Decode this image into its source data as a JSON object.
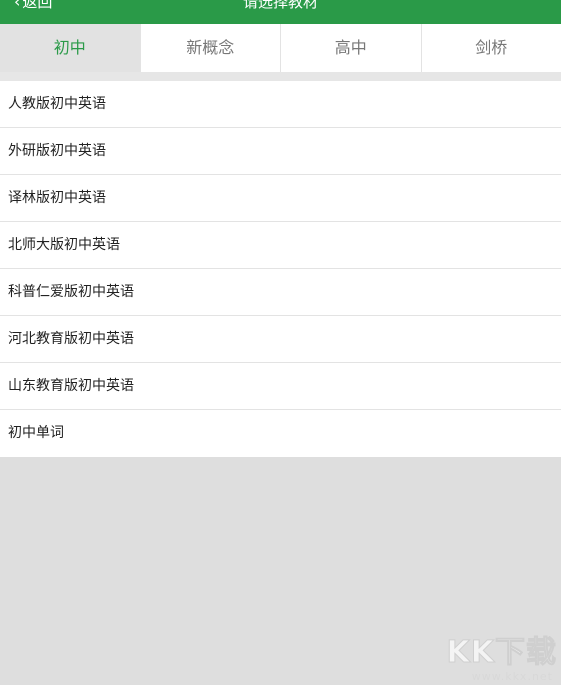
{
  "header": {
    "back_icon": "chevron-left-icon",
    "back_label": "返回",
    "title": "请选择教材",
    "background": "#2a9a48"
  },
  "tabs": [
    {
      "label": "初中",
      "active": true
    },
    {
      "label": "新概念",
      "active": false
    },
    {
      "label": "高中",
      "active": false
    },
    {
      "label": "剑桥",
      "active": false
    }
  ],
  "accent_color": "#2a9a48",
  "textbooks": [
    {
      "label": "人教版初中英语"
    },
    {
      "label": "外研版初中英语"
    },
    {
      "label": "译林版初中英语"
    },
    {
      "label": "北师大版初中英语"
    },
    {
      "label": "科普仁爱版初中英语"
    },
    {
      "label": "河北教育版初中英语"
    },
    {
      "label": "山东教育版初中英语"
    },
    {
      "label": "初中单词"
    }
  ],
  "watermark": {
    "logo": "KK下载",
    "url": "www.kkx.net"
  }
}
